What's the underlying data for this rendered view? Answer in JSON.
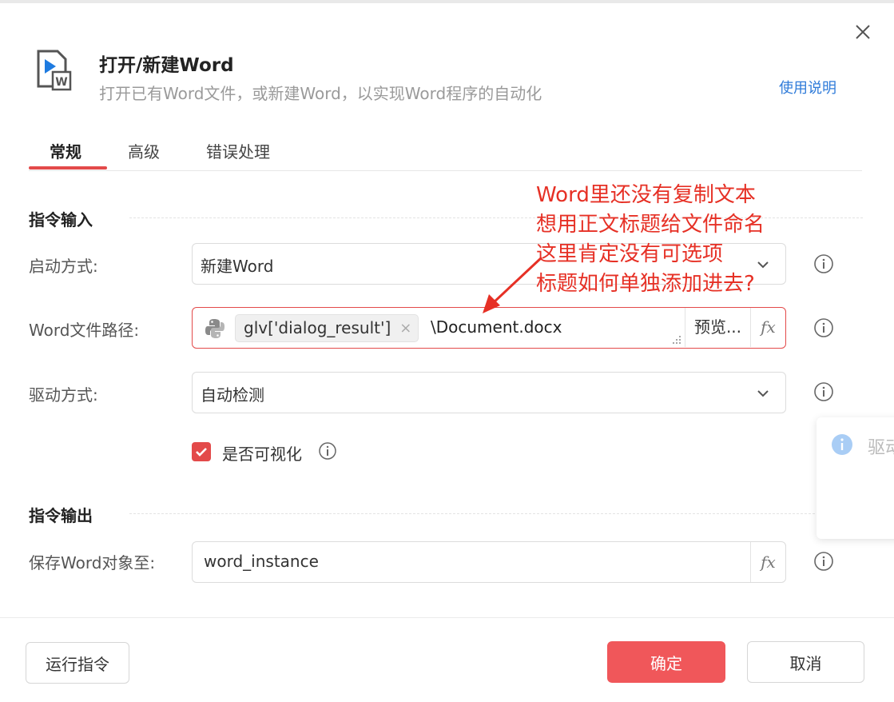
{
  "dialog": {
    "title": "打开/新建Word",
    "subtitle": "打开已有Word文件，或新建Word，以实现Word程序的自动化",
    "help_link": "使用说明"
  },
  "tabs": [
    {
      "label": "常规",
      "active": true
    },
    {
      "label": "高级",
      "active": false
    },
    {
      "label": "错误处理",
      "active": false
    }
  ],
  "input_section": {
    "title": "指令输入",
    "launch_mode": {
      "label": "启动方式:",
      "value": "新建Word"
    },
    "file_path": {
      "label": "Word文件路径:",
      "tag": "glv['dialog_result']",
      "tag_remove": "×",
      "suffix": "\\Document.docx",
      "preview": "预览...",
      "fx": "fx"
    },
    "driver_mode": {
      "label": "驱动方式:",
      "value": "自动检测"
    },
    "visible": {
      "label": "是否可视化",
      "checked": true
    }
  },
  "output_section": {
    "title": "指令输出",
    "save_to": {
      "label": "保存Word对象至:",
      "value": "word_instance",
      "fx": "fx"
    }
  },
  "footer": {
    "run_label": "运行指令",
    "confirm_label": "确定",
    "cancel_label": "取消"
  },
  "annotation": {
    "lines": "Word里还没有复制文本\n想用正文标题给文件命名\n这里肯定没有可选项\n标题如何单独添加进去?"
  },
  "toast": {
    "text": "驱动"
  },
  "colors": {
    "accent": "#e34a4a",
    "link": "#2f7bd9",
    "annotation": "#e63025",
    "primary_button": "#f0575a"
  }
}
